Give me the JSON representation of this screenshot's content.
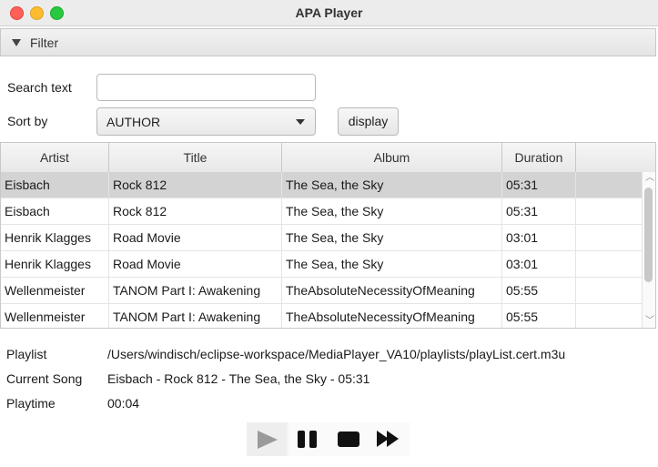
{
  "window": {
    "title": "APA Player"
  },
  "filter": {
    "header_label": "Filter",
    "search_label": "Search text",
    "search_value": "",
    "search_placeholder": "",
    "sort_label": "Sort by",
    "sort_value": "AUTHOR",
    "display_button": "display"
  },
  "table": {
    "columns": [
      "Artist",
      "Title",
      "Album",
      "Duration"
    ],
    "rows": [
      {
        "artist": "Eisbach",
        "title": "Rock 812",
        "album": "The Sea, the Sky",
        "duration": "05:31",
        "selected": true
      },
      {
        "artist": "Eisbach",
        "title": "Rock 812",
        "album": "The Sea, the Sky",
        "duration": "05:31",
        "selected": false
      },
      {
        "artist": "Henrik Klagges",
        "title": "Road Movie",
        "album": "The Sea, the Sky",
        "duration": "03:01",
        "selected": false
      },
      {
        "artist": "Henrik Klagges",
        "title": "Road Movie",
        "album": "The Sea, the Sky",
        "duration": "03:01",
        "selected": false
      },
      {
        "artist": "Wellenmeister",
        "title": "TANOM Part I: Awakening",
        "album": "TheAbsoluteNecessityOfMeaning",
        "duration": "05:55",
        "selected": false
      },
      {
        "artist": "Wellenmeister",
        "title": "TANOM Part I: Awakening",
        "album": "TheAbsoluteNecessityOfMeaning",
        "duration": "05:55",
        "selected": false
      }
    ]
  },
  "info": {
    "playlist_label": "Playlist",
    "playlist_value": "/Users/windisch/eclipse-workspace/MediaPlayer_VA10/playlists/playList.cert.m3u",
    "current_song_label": "Current Song",
    "current_song_value": "Eisbach - Rock 812 - The Sea, the Sky - 05:31",
    "playtime_label": "Playtime",
    "playtime_value": "00:04"
  },
  "controls": {
    "play_icon": "play-icon",
    "pause_icon": "pause-icon",
    "stop_icon": "stop-icon",
    "fast_forward_icon": "fast-forward-icon",
    "play_enabled": false
  },
  "colors": {
    "selected_row": "#d3d3d3",
    "close": "#fe5f57",
    "minimize": "#febc2e",
    "maximize": "#28c840"
  }
}
